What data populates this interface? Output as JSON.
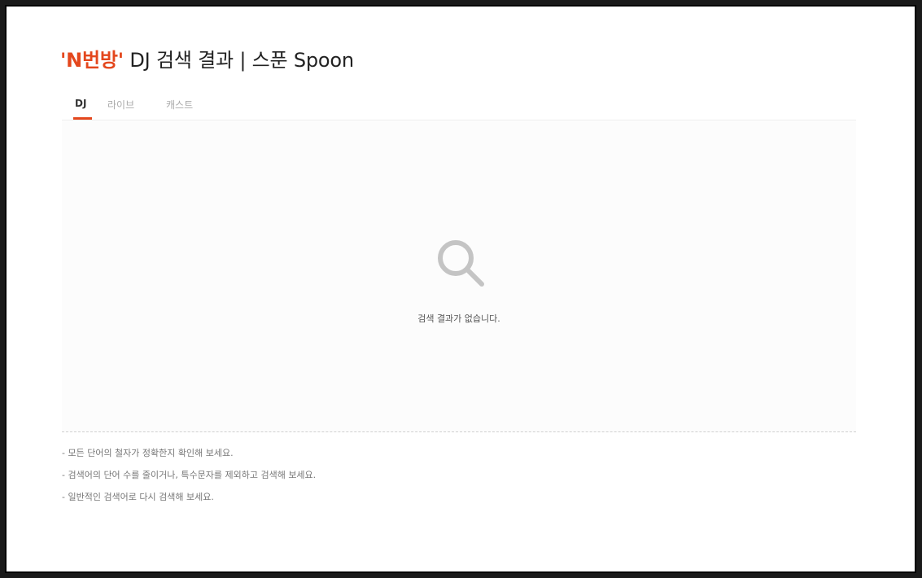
{
  "header": {
    "title_keyword": "'N번방'",
    "title_rest": " DJ 검색 결과 | 스푼 Spoon"
  },
  "tabs": [
    {
      "label": "DJ",
      "active": true
    },
    {
      "label": "라이브",
      "active": false
    },
    {
      "label": "캐스트",
      "active": false
    }
  ],
  "results": {
    "icon": "search-icon",
    "empty_message": "검색 결과가 없습니다."
  },
  "tips": [
    "- 모든 단어의 철자가 정확한지 확인해 보세요.",
    "- 검색어의 단어 수를 줄이거나, 특수문자를 제외하고 검색해 보세요.",
    "- 일반적인 검색어로 다시 검색해 보세요."
  ],
  "colors": {
    "accent": "#e4471d",
    "icon_gray": "#c4c4c4"
  }
}
